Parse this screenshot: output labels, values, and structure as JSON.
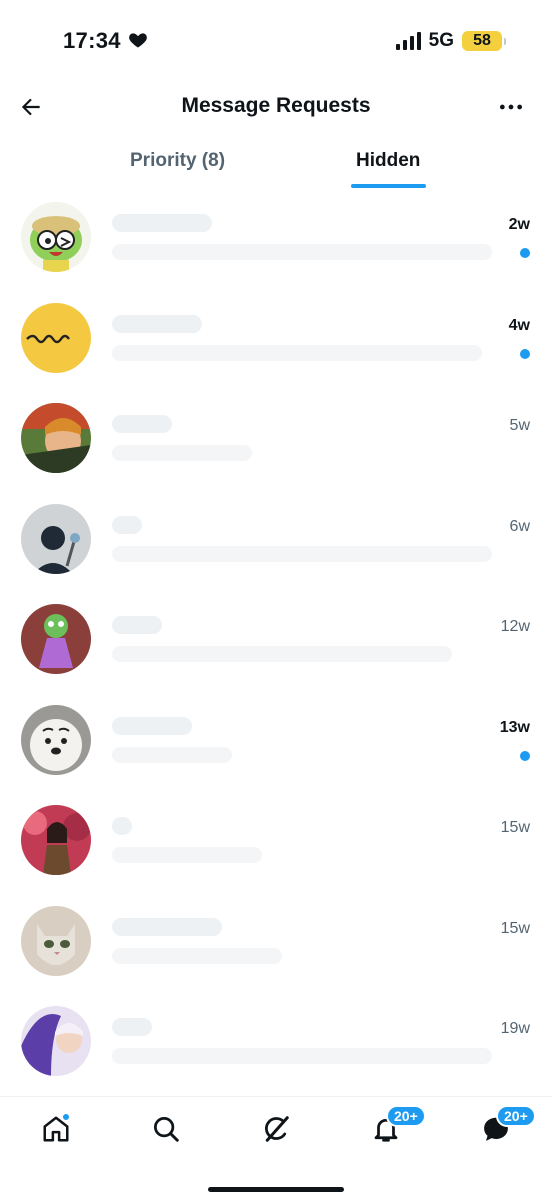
{
  "status_bar": {
    "time": "17:34",
    "network": "5G",
    "battery": "58"
  },
  "header": {
    "title": "Message Requests"
  },
  "tabs": [
    {
      "label": "Priority (8)",
      "active": false
    },
    {
      "label": "Hidden",
      "active": true
    }
  ],
  "colors": {
    "accent": "#1d9bf0",
    "text_primary": "#0f1419",
    "text_secondary": "#536471",
    "battery": "#f4d03f"
  },
  "requests": [
    {
      "time": "2w",
      "unread": true,
      "avatar": "cartoon-frog-soldier"
    },
    {
      "time": "4w",
      "unread": true,
      "avatar": "yellow-sehun-logo"
    },
    {
      "time": "5w",
      "unread": false,
      "avatar": "person-photo"
    },
    {
      "time": "6w",
      "unread": false,
      "avatar": "grey-pattern"
    },
    {
      "time": "12w",
      "unread": false,
      "avatar": "chameleon-costume"
    },
    {
      "time": "13w",
      "unread": true,
      "avatar": "white-dog"
    },
    {
      "time": "15w",
      "unread": false,
      "avatar": "person-red-trees"
    },
    {
      "time": "15w",
      "unread": false,
      "avatar": "cat-face"
    },
    {
      "time": "19w",
      "unread": false,
      "avatar": "person-purple-fur"
    }
  ],
  "bottom_nav": {
    "items": [
      {
        "icon": "home-icon",
        "has_dot": true
      },
      {
        "icon": "search-icon"
      },
      {
        "icon": "grok-icon"
      },
      {
        "icon": "bell-icon",
        "badge": "20+"
      },
      {
        "icon": "messages-icon",
        "badge": "20+"
      }
    ]
  }
}
